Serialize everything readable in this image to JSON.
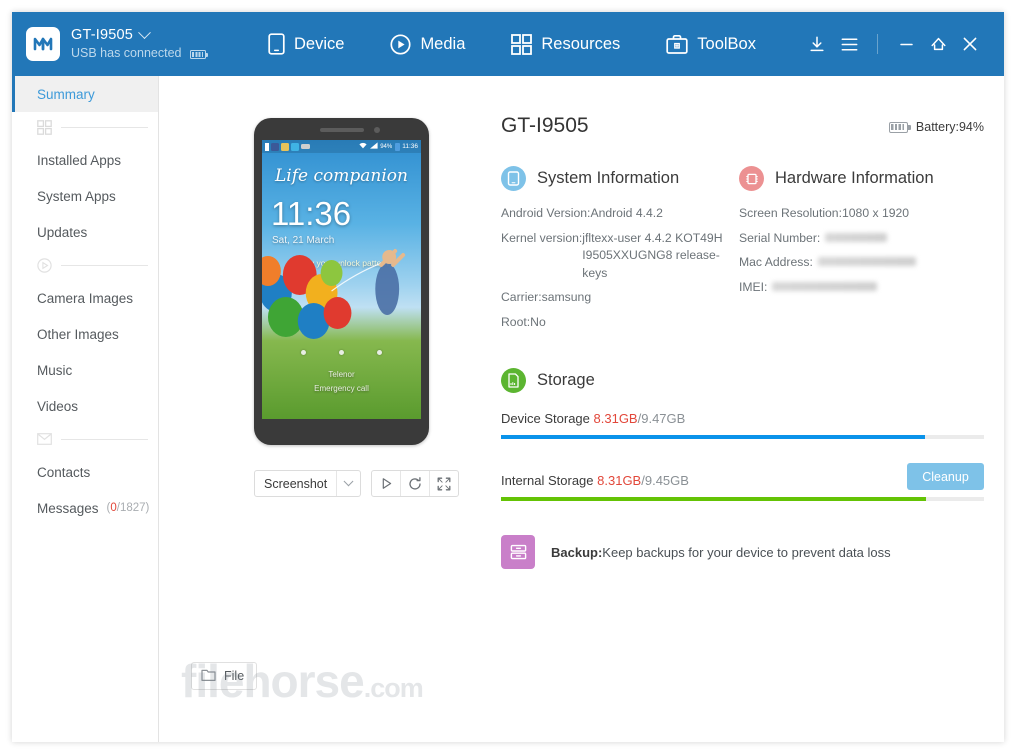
{
  "window": {
    "background": "#ffffff",
    "accent_blue": "#2277b8"
  },
  "header": {
    "logo_icon": "mobilego-m-logo-icon",
    "device_name": "GT-I9505",
    "device_dropdown_icon": "chevron-down-icon",
    "connection_status": "USB has connected",
    "connection_battery_icon": "battery-icon",
    "nav": [
      {
        "label": "Device",
        "icon": "phone-icon"
      },
      {
        "label": "Media",
        "icon": "play-circle-icon"
      },
      {
        "label": "Resources",
        "icon": "grid-icon"
      },
      {
        "label": "ToolBox",
        "icon": "toolbox-icon"
      }
    ],
    "tools": [
      {
        "name": "download",
        "icon": "download-icon"
      },
      {
        "name": "menu",
        "icon": "hamburger-menu-icon"
      }
    ],
    "window_controls": [
      {
        "name": "minimize",
        "icon": "minimize-icon"
      },
      {
        "name": "home",
        "icon": "home-icon"
      },
      {
        "name": "close",
        "icon": "close-icon"
      }
    ]
  },
  "sidebar": {
    "items": [
      {
        "type": "item",
        "label": "Summary",
        "active": true,
        "count": null
      },
      {
        "type": "sep",
        "icon": "grid-icon"
      },
      {
        "type": "item",
        "label": "Installed Apps",
        "active": false,
        "count": null
      },
      {
        "type": "item",
        "label": "System Apps",
        "active": false,
        "count": null
      },
      {
        "type": "item",
        "label": "Updates",
        "active": false,
        "count": null
      },
      {
        "type": "sep",
        "icon": "play-circle-icon"
      },
      {
        "type": "item",
        "label": "Camera Images",
        "active": false,
        "count": null
      },
      {
        "type": "item",
        "label": "Other Images",
        "active": false,
        "count": null
      },
      {
        "type": "item",
        "label": "Music",
        "active": false,
        "count": null
      },
      {
        "type": "item",
        "label": "Videos",
        "active": false,
        "count": null
      },
      {
        "type": "sep",
        "icon": "envelope-icon"
      },
      {
        "type": "item",
        "label": "Contacts",
        "active": false,
        "count": null
      },
      {
        "type": "item",
        "label": "Messages",
        "active": false,
        "count_unread": "0",
        "count_total": "/1827)",
        "count_open": "("
      }
    ]
  },
  "phone_preview": {
    "lock_tagline": "Life companion",
    "clock": "11:36",
    "date": "Sat, 21 March",
    "unlock_hint": "Draw your unlock pattern",
    "carrier": "Telenor",
    "emergency": "Emergency call",
    "status_bar": {
      "battery_percent": "94%",
      "time": "11:36"
    },
    "controls": {
      "mode_label": "Screenshot",
      "mode_caret_icon": "chevron-down-icon",
      "buttons": [
        {
          "name": "play",
          "icon": "play-triangle-icon"
        },
        {
          "name": "refresh",
          "icon": "refresh-icon"
        },
        {
          "name": "fullscreen",
          "icon": "fullscreen-icon"
        }
      ]
    }
  },
  "device": {
    "title": "GT-I9505",
    "battery_label": "Battery:94%",
    "battery_icon": "battery-icon"
  },
  "system_information": {
    "title": "System Information",
    "icon": "phone-circle-icon",
    "icon_color": "#7ec2e8",
    "rows": [
      {
        "key": "Android Version:",
        "value": "Android 4.4.2"
      },
      {
        "key": "Kernel version:",
        "value": "jfltexx-user 4.4.2 KOT49H I9505XXUGNG8 release-keys"
      },
      {
        "key": "Carrier:",
        "value": "samsung"
      },
      {
        "key": "Root:",
        "value": "No"
      }
    ]
  },
  "hardware_information": {
    "title": "Hardware Information",
    "icon": "chip-circle-icon",
    "icon_color": "#ec9192",
    "rows": [
      {
        "key": "Screen Resolution:",
        "value": "1080 x 1920",
        "redacted": false
      },
      {
        "key": "Serial Number:",
        "value": "",
        "redacted": true,
        "redacted_width": 62
      },
      {
        "key": "Mac Address:",
        "value": "",
        "redacted": true,
        "redacted_width": 98
      },
      {
        "key": "IMEI:",
        "value": "",
        "redacted": true,
        "redacted_width": 105
      }
    ]
  },
  "storage": {
    "title": "Storage",
    "icon": "sdcard-circle-icon",
    "icon_color": "#5cb531",
    "cleanup_label": "Cleanup",
    "bars": [
      {
        "label": "Device Storage",
        "used": "8.31GB",
        "total": "/9.47GB",
        "percent": 87.7,
        "color": "#0a93ea"
      },
      {
        "label": "Internal Storage",
        "used": "8.31GB",
        "total": "/9.45GB",
        "percent": 87.9,
        "color": "#64c305"
      }
    ]
  },
  "backup": {
    "icon": "backup-drawer-icon",
    "icon_color": "#c97fc9",
    "title": "Backup:",
    "description": "Keep backups for your device to prevent data loss"
  },
  "footer": {
    "file_button_label": "File",
    "file_button_icon": "folder-icon",
    "watermark": "filehorse",
    "watermark_suffix": ".com"
  }
}
